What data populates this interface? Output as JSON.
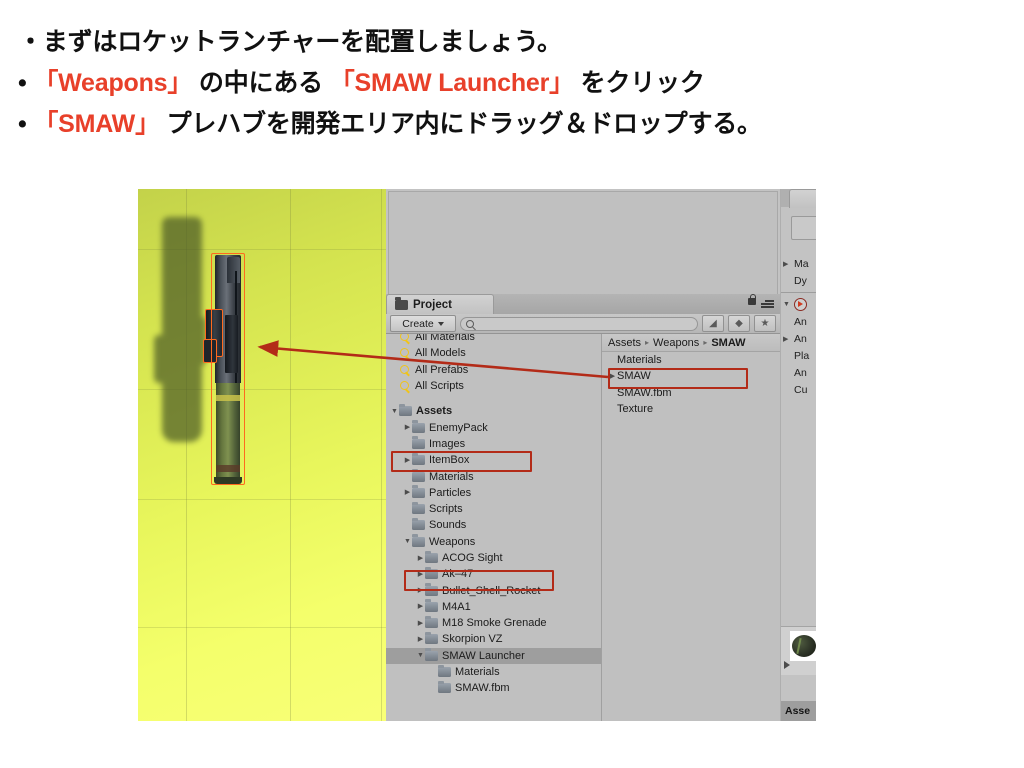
{
  "slide": {
    "bullets": [
      {
        "marker": "・",
        "segments": [
          {
            "text": "まずはロケットランチャーを配置しましょう。",
            "color": "black"
          }
        ]
      },
      {
        "marker": "•",
        "segments": [
          {
            "text": "「Weapons」",
            "color": "red"
          },
          {
            "text": " の中にある ",
            "color": "black"
          },
          {
            "text": "「SMAW Launcher」",
            "color": "red"
          },
          {
            "text": " をクリック",
            "color": "black"
          }
        ]
      },
      {
        "marker": "•",
        "segments": [
          {
            "text": "「SMAW」",
            "color": "red"
          },
          {
            "text": " プレハブを開発エリア内にドラッグ＆ドロップする。",
            "color": "black"
          }
        ]
      }
    ],
    "line1_full": "・まずはロケットランチャーを配置しましょう。",
    "line2_red1": "「Weapons」",
    "line2_mid": " の中にある ",
    "line2_red2": "「SMAW Launcher」",
    "line2_end": " をクリック",
    "line3_red1": "「SMAW」",
    "line3_end": " プレハブを開発エリア内にドラッグ＆ドロップする。",
    "bullet_dot_1": "・",
    "bullet_dot_2": "•",
    "bullet_dot_3": "•",
    "accent_red": "#E8402A",
    "text_black": "#111111"
  },
  "unity": {
    "project_panel": {
      "tab_label": "Project",
      "create_button": "Create",
      "search_placeholder": "",
      "search_value": "",
      "filter_icons": [
        "object-filter-icon",
        "label-filter-icon",
        "favorite-star-icon"
      ],
      "breadcrumb": [
        "Assets",
        "Weapons",
        "SMAW"
      ],
      "breadcrumb_separator": "▸",
      "favorites": [
        {
          "label": "All Materials",
          "icon": "search-icon"
        },
        {
          "label": "All Models",
          "icon": "search-icon"
        },
        {
          "label": "All Prefabs",
          "icon": "search-icon"
        },
        {
          "label": "All Scripts",
          "icon": "search-icon"
        }
      ],
      "tree": [
        {
          "label": "Assets",
          "indent": 0,
          "tri": "▼",
          "bold": true,
          "selected": false,
          "icon": "folder-icon"
        },
        {
          "label": "EnemyPack",
          "indent": 1,
          "tri": "▶",
          "bold": false,
          "selected": false,
          "icon": "folder-icon"
        },
        {
          "label": "Images",
          "indent": 1,
          "tri": "",
          "bold": false,
          "selected": false,
          "icon": "folder-icon"
        },
        {
          "label": "ItemBox",
          "indent": 1,
          "tri": "▶",
          "bold": false,
          "selected": false,
          "icon": "folder-icon"
        },
        {
          "label": "Materials",
          "indent": 1,
          "tri": "",
          "bold": false,
          "selected": false,
          "icon": "folder-icon"
        },
        {
          "label": "Particles",
          "indent": 1,
          "tri": "▶",
          "bold": false,
          "selected": false,
          "icon": "folder-icon"
        },
        {
          "label": "Scripts",
          "indent": 1,
          "tri": "",
          "bold": false,
          "selected": false,
          "icon": "folder-icon"
        },
        {
          "label": "Sounds",
          "indent": 1,
          "tri": "",
          "bold": false,
          "selected": false,
          "icon": "folder-icon"
        },
        {
          "label": "Weapons",
          "indent": 1,
          "tri": "▼",
          "bold": false,
          "selected": false,
          "icon": "folder-icon"
        },
        {
          "label": "ACOG Sight",
          "indent": 2,
          "tri": "▶",
          "bold": false,
          "selected": false,
          "icon": "folder-icon"
        },
        {
          "label": "Ak–47",
          "indent": 2,
          "tri": "▶",
          "bold": false,
          "selected": false,
          "icon": "folder-icon"
        },
        {
          "label": "Bullet_Shell_Rocket",
          "indent": 2,
          "tri": "▶",
          "bold": false,
          "selected": false,
          "icon": "folder-icon"
        },
        {
          "label": "M4A1",
          "indent": 2,
          "tri": "▶",
          "bold": false,
          "selected": false,
          "icon": "folder-icon"
        },
        {
          "label": "M18 Smoke Grenade",
          "indent": 2,
          "tri": "▶",
          "bold": false,
          "selected": false,
          "icon": "folder-icon"
        },
        {
          "label": "Skorpion VZ",
          "indent": 2,
          "tri": "▶",
          "bold": false,
          "selected": false,
          "icon": "folder-icon"
        },
        {
          "label": "SMAW Launcher",
          "indent": 2,
          "tri": "▼",
          "bold": false,
          "selected": true,
          "icon": "folder-icon"
        },
        {
          "label": "Materials",
          "indent": 3,
          "tri": "",
          "bold": false,
          "selected": false,
          "icon": "folder-icon"
        },
        {
          "label": "SMAW.fbm",
          "indent": 3,
          "tri": "",
          "bold": false,
          "selected": false,
          "icon": "folder-icon"
        }
      ],
      "contents": [
        {
          "label": "Materials",
          "tri": "",
          "icon": "folder-icon"
        },
        {
          "label": "SMAW",
          "tri": "▶",
          "icon": "prefab-icon"
        },
        {
          "label": "SMAW.fbm",
          "tri": "",
          "icon": "folder-icon"
        },
        {
          "label": "Texture",
          "tri": "",
          "icon": "folder-icon"
        }
      ]
    },
    "inspector": {
      "rows": [
        {
          "label": "Ma",
          "tri": "▶"
        },
        {
          "label": "Dy",
          "tri": ""
        },
        {
          "label": "",
          "tri": "▼",
          "icon": "play-icon"
        },
        {
          "label": "An",
          "tri": ""
        },
        {
          "label": "An",
          "tri": "▶"
        },
        {
          "label": "Pla",
          "tri": ""
        },
        {
          "label": "An",
          "tri": ""
        },
        {
          "label": "Cu",
          "tri": ""
        }
      ],
      "bottom_tab": "Asse"
    },
    "annotations": {
      "color": "#b32b18",
      "boxes": [
        "weapons-folder-box",
        "smaw-launcher-folder-box",
        "smaw-prefab-box"
      ],
      "arrow": "smaw-prefab-to-scene-arrow"
    },
    "scene": {
      "object": "SMAW rocket launcher",
      "selection_outline_color": "#ff6a1e",
      "background_colors": [
        "#c3d24a",
        "#f8ff77"
      ]
    }
  }
}
